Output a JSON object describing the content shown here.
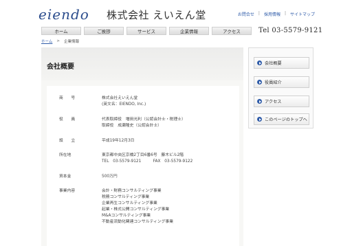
{
  "header": {
    "logo": "eiendo",
    "company": "株式会社 えいえん堂",
    "links": [
      "お問合せ",
      "採用情報",
      "サイトマップ"
    ],
    "tel": "Tel 03-5579-9121"
  },
  "nav": {
    "items": [
      "ホーム",
      "ご挨拶",
      "サービス",
      "企業情報",
      "アクセス"
    ]
  },
  "breadcrumb": {
    "home": "ホーム",
    "separator": ">",
    "current": "企業情報"
  },
  "main": {
    "title": "会社概要",
    "rows": [
      {
        "label": "商　　号",
        "lines": [
          "株式会社えいえん堂",
          "(英文名：EIENDO, Inc.)"
        ]
      },
      {
        "label": "役　　員",
        "lines": [
          "代表取締役　増田光利（公認会計士・税理士）",
          "取締役　成瀬隆史（公認会計士）"
        ]
      },
      {
        "label": "設　　立",
        "lines": [
          "平成19年12月3日"
        ]
      },
      {
        "label": "所在地",
        "lines": [
          "東京都中央区京橋2丁目6番6号　藤木ビル2階",
          "TEL　03-5579-9121　　　FAX　03-5579-9122"
        ]
      },
      {
        "label": "資本金",
        "lines": [
          "500万円"
        ]
      },
      {
        "label": "事業内容",
        "lines": [
          "会計・財務コンサルティング事業",
          "税務コンサルティング事業",
          "企業再生コンサルティング事業",
          "起業・株式公開コンサルティング事業",
          "M&Aコンサルティング事業",
          "不動産流動化関連コンサルティング事業"
        ]
      }
    ]
  },
  "sidebar": {
    "items": [
      "会社概要",
      "役員紹介",
      "アクセス",
      "このページのトップへ"
    ]
  },
  "colors": {
    "accent": "#2d5aa8",
    "logo": "#2b4c8c"
  }
}
